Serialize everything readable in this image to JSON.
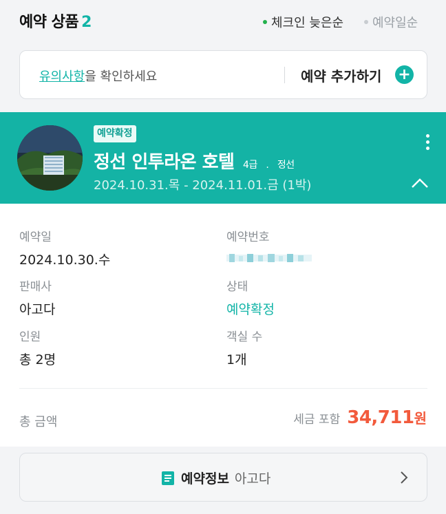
{
  "header": {
    "title": "예약 상품",
    "count": "2",
    "sort_options": [
      "체크인 늦은순",
      "예약일순"
    ],
    "sort_selected": "체크인 늦은순"
  },
  "notice": {
    "link_text": "유의사항",
    "text": "을 확인하세요",
    "add_label": "예약 추가하기"
  },
  "booking": {
    "status_badge": "예약확정",
    "hotel_name": "정선 인투라온 호텔",
    "grade": "4급",
    "separator": ".",
    "region": "정선",
    "dates": "2024.10.31.목 - 2024.11.01.금 (1박)"
  },
  "details": {
    "booking_date_label": "예약일",
    "booking_date": "2024.10.30.수",
    "booking_number_label": "예약번호",
    "seller_label": "판매사",
    "seller": "아고다",
    "status_label": "상태",
    "status": "예약확정",
    "guests_label": "인원",
    "guests": "총 2명",
    "rooms_label": "객실 수",
    "rooms": "1개"
  },
  "total": {
    "label": "총 금액",
    "tax_note": "세금 포함",
    "amount": "34,711",
    "unit": "원"
  },
  "info_button": {
    "label": "예약정보",
    "seller": "아고다"
  },
  "colors": {
    "accent": "#14b3a5",
    "price": "#f25a3c",
    "background": "#f3f4f6"
  },
  "icons": [
    "plus-circle-icon",
    "more-vertical-icon",
    "chevron-up-icon",
    "document-icon",
    "chevron-right-icon"
  ]
}
